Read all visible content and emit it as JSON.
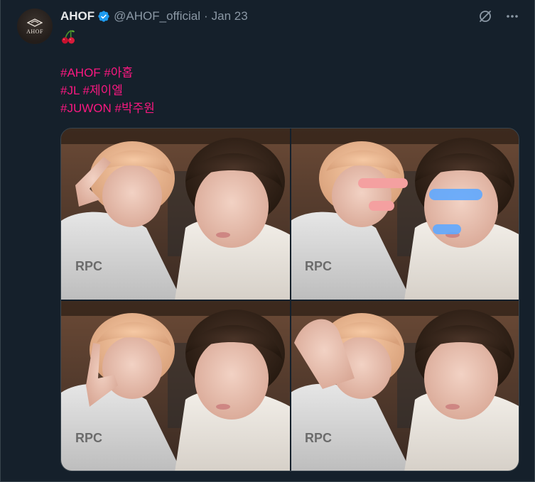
{
  "tweet": {
    "author": {
      "display_name": "AHOF",
      "handle": "@AHOF_official",
      "avatar_text": "AHOF",
      "verified": true
    },
    "separator": "·",
    "date": "Jan 23",
    "emoji_icon": "cherry-icon",
    "hashtag_lines": [
      [
        "#AHOF",
        "#아홉"
      ],
      [
        "#JL",
        "#제이엘"
      ],
      [
        "#JUWON",
        "#박주원"
      ]
    ],
    "media": {
      "type": "photo-grid",
      "panels": 4
    }
  },
  "icons": {
    "verified": "verified-badge-icon",
    "grok": "grok-icon",
    "more": "more-options-icon"
  },
  "colors": {
    "background": "#15202b",
    "text_primary": "#e7e9ea",
    "text_secondary": "#8b98a5",
    "hashtag": "#f91880",
    "verified": "#1d9bf0",
    "border": "#38444d"
  }
}
